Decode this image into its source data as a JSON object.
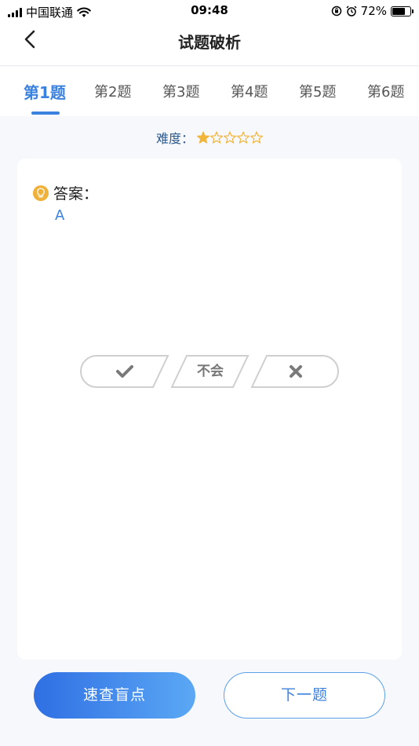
{
  "status_bar": {
    "carrier": "中国联通",
    "time": "09:48",
    "battery_percent": "72%",
    "battery_level": 0.72
  },
  "nav": {
    "title": "试题破析",
    "back_icon": "chevron-left-icon"
  },
  "tabs": [
    {
      "label": "第1题",
      "active": true
    },
    {
      "label": "第2题",
      "active": false
    },
    {
      "label": "第3题",
      "active": false
    },
    {
      "label": "第4题",
      "active": false
    },
    {
      "label": "第5题",
      "active": false
    },
    {
      "label": "第6题",
      "active": false
    }
  ],
  "difficulty": {
    "label": "难度：",
    "rating": 1,
    "max": 5
  },
  "answer": {
    "label": "答案：",
    "value": "A"
  },
  "judge": {
    "correct_icon": "checkmark-icon",
    "unknown_label": "不会",
    "wrong_icon": "cross-icon"
  },
  "buttons": {
    "quick_check": "速查盲点",
    "next": "下一题"
  },
  "colors": {
    "accent": "#3b82e0",
    "star": "#f2b53b",
    "gradient_start": "#2f6fe3",
    "gradient_end": "#5ba8f5"
  }
}
